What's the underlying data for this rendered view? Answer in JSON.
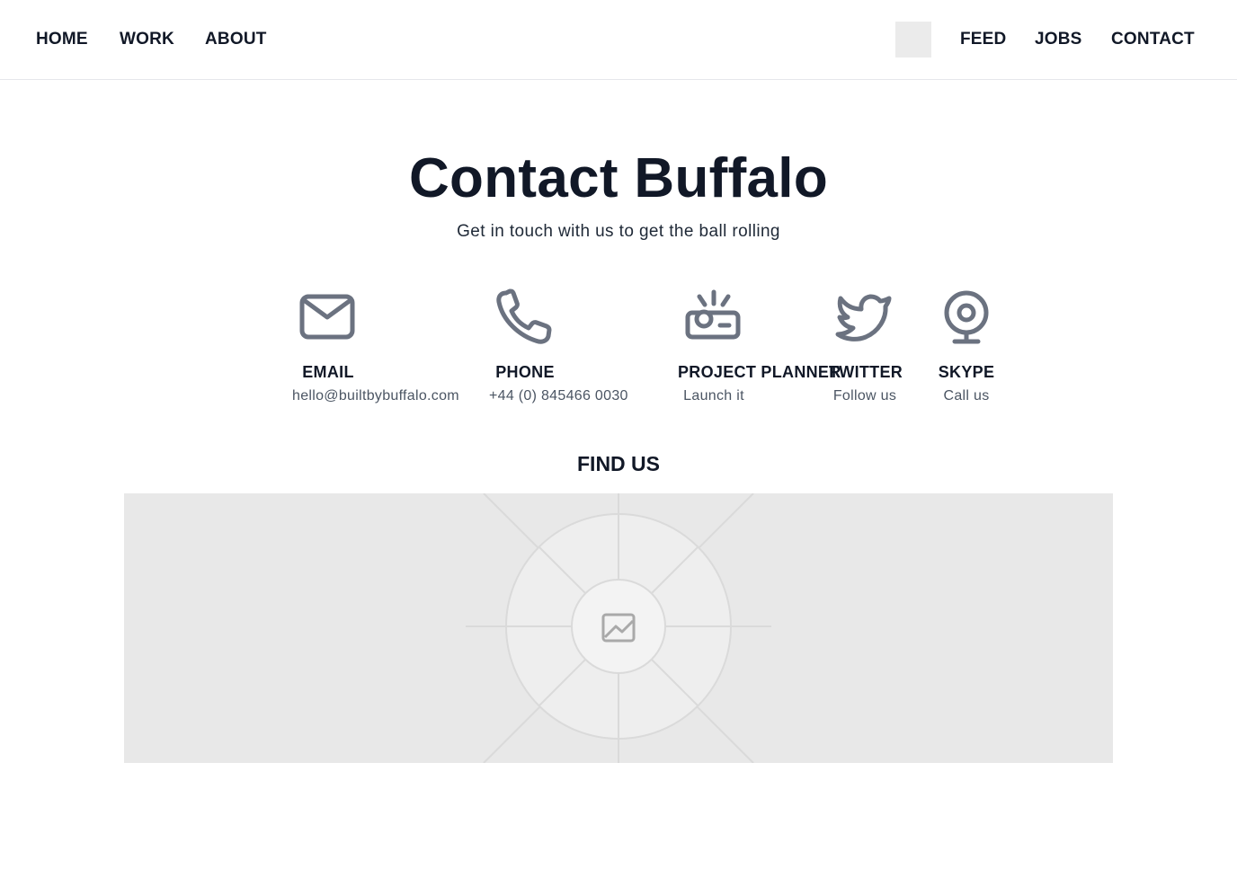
{
  "nav": {
    "left": [
      "HOME",
      "WORK",
      "ABOUT"
    ],
    "right": [
      "FEED",
      "JOBS",
      "CONTACT"
    ],
    "logo_icon": "logo-placeholder"
  },
  "page": {
    "title": "Contact Buffalo",
    "subtitle": "Get in touch with us to get the ball rolling"
  },
  "contacts": [
    {
      "icon": "envelope-icon",
      "label": "EMAIL",
      "value": "hello@builtbybuffalo.com"
    },
    {
      "icon": "phone-icon",
      "label": "PHONE",
      "value": "+44 (0) 845466 0030"
    },
    {
      "icon": "projector-icon",
      "label": "PROJECT PLANNER",
      "value": "Launch it"
    },
    {
      "icon": "twitter-bird-icon",
      "label": "TWITTER",
      "value": "Follow us"
    },
    {
      "icon": "webcam-icon",
      "label": "SKYPE",
      "value": "Call us"
    }
  ],
  "find_us": {
    "heading": "FIND US",
    "map_icon": "image-placeholder-icon"
  },
  "colors": {
    "text": "#111827",
    "muted": "#4b5563",
    "icon": "#6b7280",
    "placeholder": "#e8e8e8"
  }
}
